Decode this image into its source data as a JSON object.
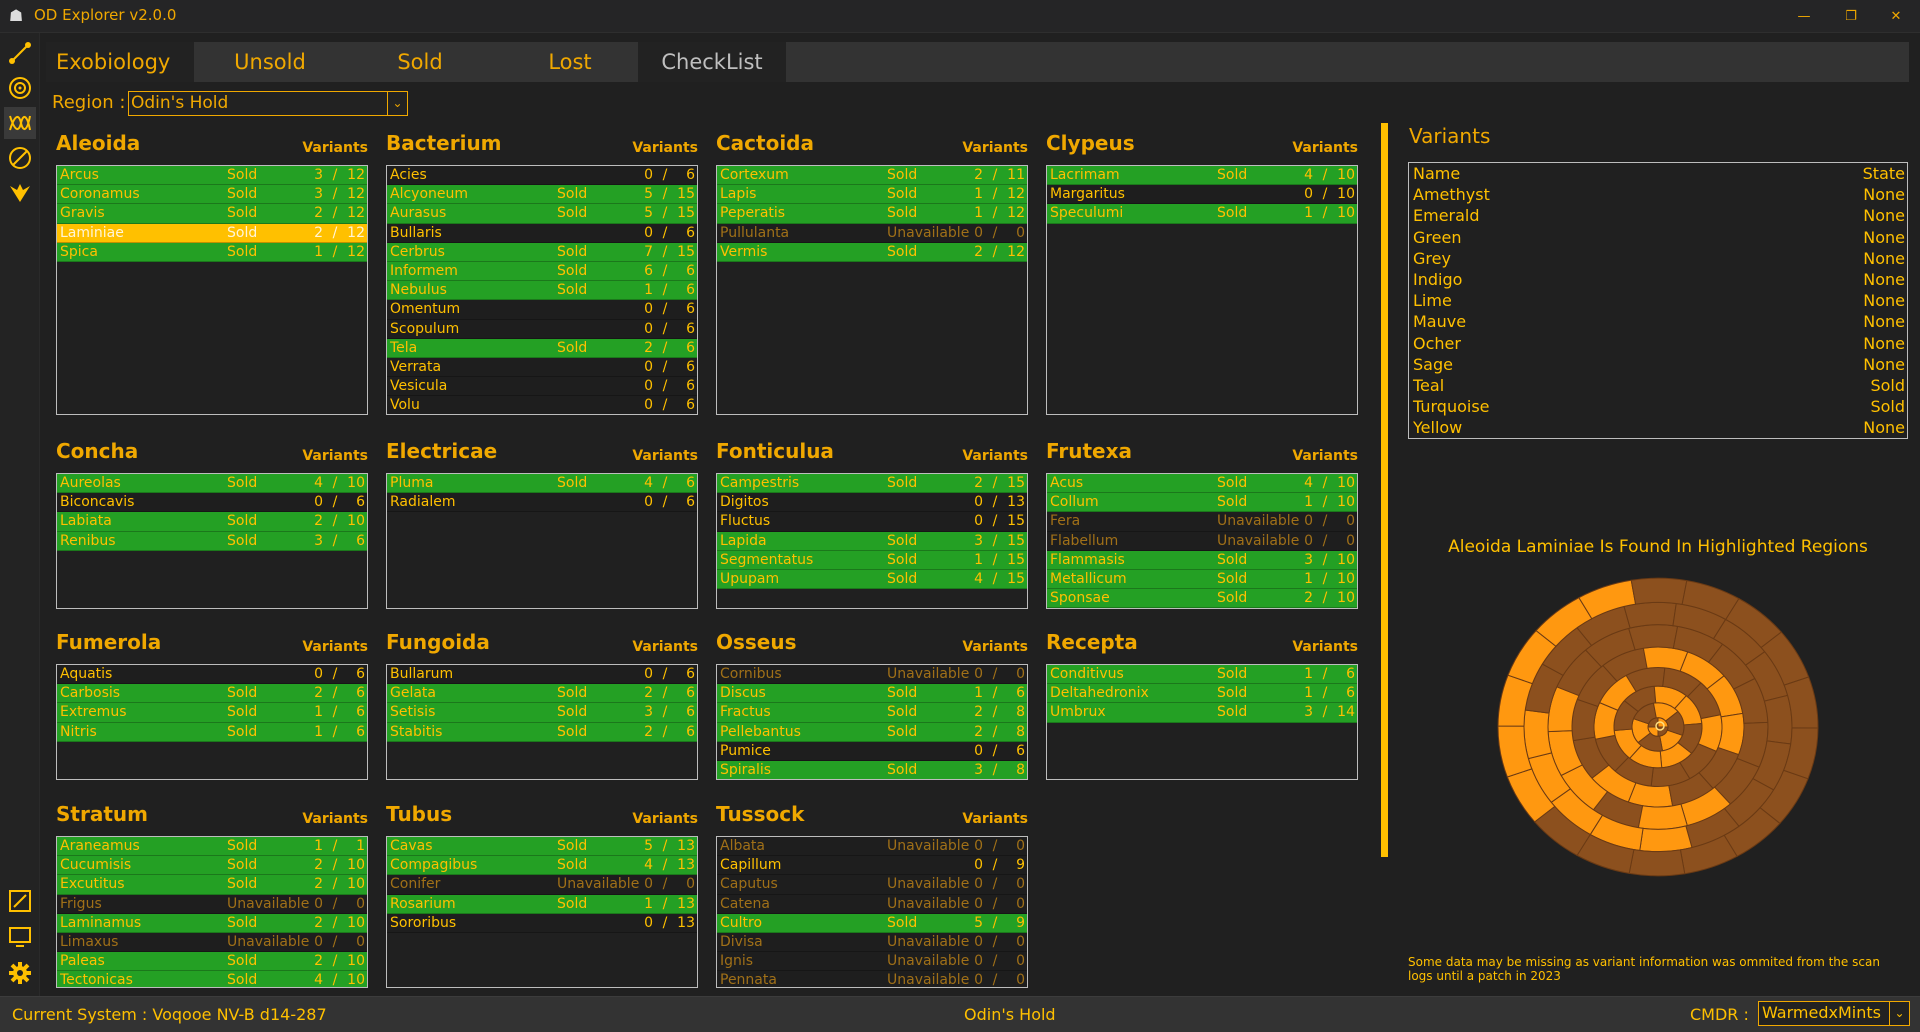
{
  "window": {
    "title": "OD Explorer v2.0.0",
    "minimize": "—",
    "restore": "❐",
    "close": "✕"
  },
  "tabs": [
    "Exobiology",
    "Unsold",
    "Sold",
    "Lost",
    "CheckList"
  ],
  "region": {
    "label": "Region :",
    "value": "Odin's Hold",
    "dropdown": "⌄"
  },
  "variants_header": "Variants",
  "groups": [
    {
      "name": "Aleoida",
      "rows": [
        [
          "Arcus",
          "Sold",
          "3",
          "12",
          "sold"
        ],
        [
          "Coronamus",
          "Sold",
          "3",
          "12",
          "sold"
        ],
        [
          "Gravis",
          "Sold",
          "2",
          "12",
          "sold"
        ],
        [
          "Laminiae",
          "Sold",
          "2",
          "12",
          "sel"
        ],
        [
          "Spica",
          "Sold",
          "1",
          "12",
          "sold"
        ]
      ]
    },
    {
      "name": "Bacterium",
      "rows": [
        [
          "Acies",
          "",
          "0",
          "6",
          "none"
        ],
        [
          "Alcyoneum",
          "Sold",
          "5",
          "15",
          "sold"
        ],
        [
          "Aurasus",
          "Sold",
          "5",
          "15",
          "sold"
        ],
        [
          "Bullaris",
          "",
          "0",
          "6",
          "none"
        ],
        [
          "Cerbrus",
          "Sold",
          "7",
          "15",
          "sold"
        ],
        [
          "Informem",
          "Sold",
          "6",
          "6",
          "sold"
        ],
        [
          "Nebulus",
          "Sold",
          "1",
          "6",
          "sold"
        ],
        [
          "Omentum",
          "",
          "0",
          "6",
          "none"
        ],
        [
          "Scopulum",
          "",
          "0",
          "6",
          "none"
        ],
        [
          "Tela",
          "Sold",
          "2",
          "6",
          "sold"
        ],
        [
          "Verrata",
          "",
          "0",
          "6",
          "none"
        ],
        [
          "Vesicula",
          "",
          "0",
          "6",
          "none"
        ],
        [
          "Volu",
          "",
          "0",
          "6",
          "none"
        ]
      ]
    },
    {
      "name": "Cactoida",
      "rows": [
        [
          "Cortexum",
          "Sold",
          "2",
          "11",
          "sold"
        ],
        [
          "Lapis",
          "Sold",
          "1",
          "12",
          "sold"
        ],
        [
          "Peperatis",
          "Sold",
          "1",
          "12",
          "sold"
        ],
        [
          "Pullulanta",
          "Unavailable",
          "0",
          "0",
          "unav"
        ],
        [
          "Vermis",
          "Sold",
          "2",
          "12",
          "sold"
        ]
      ]
    },
    {
      "name": "Clypeus",
      "rows": [
        [
          "Lacrimam",
          "Sold",
          "4",
          "10",
          "sold"
        ],
        [
          "Margaritus",
          "",
          "0",
          "10",
          "none"
        ],
        [
          "Speculumi",
          "Sold",
          "1",
          "10",
          "sold"
        ]
      ]
    },
    {
      "name": "Concha",
      "rows": [
        [
          "Aureolas",
          "Sold",
          "4",
          "10",
          "sold"
        ],
        [
          "Biconcavis",
          "",
          "0",
          "6",
          "none"
        ],
        [
          "Labiata",
          "Sold",
          "2",
          "10",
          "sold"
        ],
        [
          "Renibus",
          "Sold",
          "3",
          "6",
          "sold"
        ]
      ]
    },
    {
      "name": "Electricae",
      "rows": [
        [
          "Pluma",
          "Sold",
          "4",
          "6",
          "sold"
        ],
        [
          "Radialem",
          "",
          "0",
          "6",
          "none"
        ]
      ]
    },
    {
      "name": "Fonticulua",
      "rows": [
        [
          "Campestris",
          "Sold",
          "2",
          "15",
          "sold"
        ],
        [
          "Digitos",
          "",
          "0",
          "13",
          "none"
        ],
        [
          "Fluctus",
          "",
          "0",
          "15",
          "none"
        ],
        [
          "Lapida",
          "Sold",
          "3",
          "15",
          "sold"
        ],
        [
          "Segmentatus",
          "Sold",
          "1",
          "15",
          "sold"
        ],
        [
          "Upupam",
          "Sold",
          "4",
          "15",
          "sold"
        ]
      ]
    },
    {
      "name": "Frutexa",
      "rows": [
        [
          "Acus",
          "Sold",
          "4",
          "10",
          "sold"
        ],
        [
          "Collum",
          "Sold",
          "1",
          "10",
          "sold"
        ],
        [
          "Fera",
          "Unavailable",
          "0",
          "0",
          "unav"
        ],
        [
          "Flabellum",
          "Unavailable",
          "0",
          "0",
          "unav"
        ],
        [
          "Flammasis",
          "Sold",
          "3",
          "10",
          "sold"
        ],
        [
          "Metallicum",
          "Sold",
          "1",
          "10",
          "sold"
        ],
        [
          "Sponsae",
          "Sold",
          "2",
          "10",
          "sold"
        ]
      ]
    },
    {
      "name": "Fumerola",
      "rows": [
        [
          "Aquatis",
          "",
          "0",
          "6",
          "none"
        ],
        [
          "Carbosis",
          "Sold",
          "2",
          "6",
          "sold"
        ],
        [
          "Extremus",
          "Sold",
          "1",
          "6",
          "sold"
        ],
        [
          "Nitris",
          "Sold",
          "1",
          "6",
          "sold"
        ]
      ]
    },
    {
      "name": "Fungoida",
      "rows": [
        [
          "Bullarum",
          "",
          "0",
          "6",
          "none"
        ],
        [
          "Gelata",
          "Sold",
          "2",
          "6",
          "sold"
        ],
        [
          "Setisis",
          "Sold",
          "3",
          "6",
          "sold"
        ],
        [
          "Stabitis",
          "Sold",
          "2",
          "6",
          "sold"
        ]
      ]
    },
    {
      "name": "Osseus",
      "rows": [
        [
          "Cornibus",
          "Unavailable",
          "0",
          "0",
          "unav"
        ],
        [
          "Discus",
          "Sold",
          "1",
          "6",
          "sold"
        ],
        [
          "Fractus",
          "Sold",
          "2",
          "8",
          "sold"
        ],
        [
          "Pellebantus",
          "Sold",
          "2",
          "8",
          "sold"
        ],
        [
          "Pumice",
          "",
          "0",
          "6",
          "none"
        ],
        [
          "Spiralis",
          "Sold",
          "3",
          "8",
          "sold"
        ]
      ]
    },
    {
      "name": "Recepta",
      "rows": [
        [
          "Conditivus",
          "Sold",
          "1",
          "6",
          "sold"
        ],
        [
          "Deltahedronix",
          "Sold",
          "1",
          "6",
          "sold"
        ],
        [
          "Umbrux",
          "Sold",
          "3",
          "14",
          "sold"
        ]
      ]
    },
    {
      "name": "Stratum",
      "rows": [
        [
          "Araneamus",
          "Sold",
          "1",
          "1",
          "sold"
        ],
        [
          "Cucumisis",
          "Sold",
          "2",
          "10",
          "sold"
        ],
        [
          "Excutitus",
          "Sold",
          "2",
          "10",
          "sold"
        ],
        [
          "Frigus",
          "Unavailable",
          "0",
          "0",
          "unav"
        ],
        [
          "Laminamus",
          "Sold",
          "2",
          "10",
          "sold"
        ],
        [
          "Limaxus",
          "Unavailable",
          "0",
          "0",
          "unav"
        ],
        [
          "Paleas",
          "Sold",
          "2",
          "10",
          "sold"
        ],
        [
          "Tectonicas",
          "Sold",
          "4",
          "10",
          "sold"
        ]
      ]
    },
    {
      "name": "Tubus",
      "rows": [
        [
          "Cavas",
          "Sold",
          "5",
          "13",
          "sold"
        ],
        [
          "Compagibus",
          "Sold",
          "4",
          "13",
          "sold"
        ],
        [
          "Conifer",
          "Unavailable",
          "0",
          "0",
          "unav"
        ],
        [
          "Rosarium",
          "Sold",
          "1",
          "13",
          "sold"
        ],
        [
          "Sororibus",
          "",
          "0",
          "13",
          "none"
        ]
      ]
    },
    {
      "name": "Tussock",
      "rows": [
        [
          "Albata",
          "Unavailable",
          "0",
          "0",
          "unav"
        ],
        [
          "Capillum",
          "",
          "0",
          "9",
          "none"
        ],
        [
          "Caputus",
          "Unavailable",
          "0",
          "0",
          "unav"
        ],
        [
          "Catena",
          "Unavailable",
          "0",
          "0",
          "unav"
        ],
        [
          "Cultro",
          "Sold",
          "5",
          "9",
          "sold"
        ],
        [
          "Divisa",
          "Unavailable",
          "0",
          "0",
          "unav"
        ],
        [
          "Ignis",
          "Unavailable",
          "0",
          "0",
          "unav"
        ],
        [
          "Pennata",
          "Unavailable",
          "0",
          "0",
          "unav"
        ]
      ]
    }
  ],
  "variants_panel": {
    "title": "Variants",
    "col_name": "Name",
    "col_state": "State",
    "rows": [
      [
        "Amethyst",
        "None"
      ],
      [
        "Emerald",
        "None"
      ],
      [
        "Green",
        "None"
      ],
      [
        "Grey",
        "None"
      ],
      [
        "Indigo",
        "None"
      ],
      [
        "Lime",
        "None"
      ],
      [
        "Mauve",
        "None"
      ],
      [
        "Ocher",
        "None"
      ],
      [
        "Sage",
        "None"
      ],
      [
        "Teal",
        "Sold"
      ],
      [
        "Turquoise",
        "Sold"
      ],
      [
        "Yellow",
        "None"
      ]
    ]
  },
  "found_text": "Aleoida Laminiae Is Found In Highlighted Regions",
  "note": "Some data may be missing as variant information was ommited from the scan logs until a patch in 2023",
  "status": {
    "system": "Current System :  Voqooe NV-B d14-287",
    "region": "Odin's Hold",
    "cmdr_label": "CMDR :",
    "cmdr_value": "WarmedxMints",
    "dropdown": "⌄"
  },
  "colors": {
    "sold": "#24a024",
    "accent": "#ffc000",
    "highlight_region": "#ff9810",
    "region": "#8c501e"
  },
  "icons": [
    "route-icon",
    "target-icon",
    "dna-icon",
    "compass-icon",
    "wings-icon",
    "popout-icon",
    "monitor-icon",
    "gear-icon"
  ]
}
